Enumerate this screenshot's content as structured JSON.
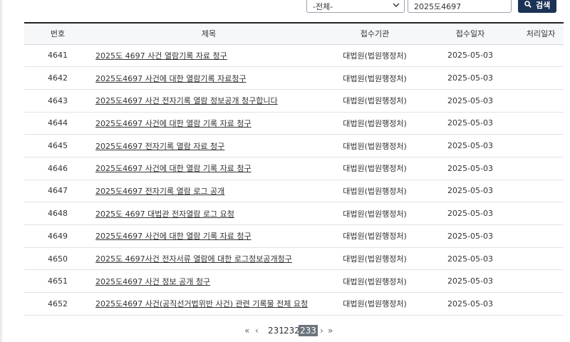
{
  "search": {
    "category_value": "-전체-",
    "query_value": "2025도4697",
    "button_label": "검색"
  },
  "table": {
    "headers": [
      "번호",
      "제목",
      "접수기관",
      "접수일자",
      "처리일자"
    ],
    "rows": [
      {
        "no": "4641",
        "title": "2025도 4697 사건 열람기록 자료 청구",
        "org": "대법원(법원행정처)",
        "date": "2025-05-03",
        "processed": ""
      },
      {
        "no": "4642",
        "title": "2025도4697 사건에 대한 열람기록 자료청구",
        "org": "대법원(법원행정처)",
        "date": "2025-05-03",
        "processed": ""
      },
      {
        "no": "4643",
        "title": "2025도4697 사건 전자기록 열람 정보공개 청구합니다",
        "org": "대법원(법원행정처)",
        "date": "2025-05-03",
        "processed": ""
      },
      {
        "no": "4644",
        "title": "2025도4697 사건에 대한 열람 기록 자료 청구",
        "org": "대법원(법원행정처)",
        "date": "2025-05-03",
        "processed": ""
      },
      {
        "no": "4645",
        "title": "2025도4697 전자기록 열람 자료 청구",
        "org": "대법원(법원행정처)",
        "date": "2025-05-03",
        "processed": ""
      },
      {
        "no": "4646",
        "title": "2025도4697 사건에 대한 열람 기록 자료 청구",
        "org": "대법원(법원행정처)",
        "date": "2025-05-03",
        "processed": ""
      },
      {
        "no": "4647",
        "title": "2025도4697 전자기록 열람 로그 공개",
        "org": "대법원(법원행정처)",
        "date": "2025-05-03",
        "processed": ""
      },
      {
        "no": "4648",
        "title": "2025도 4697 대법관 전자열람 로그 요청",
        "org": "대법원(법원행정처)",
        "date": "2025-05-03",
        "processed": ""
      },
      {
        "no": "4649",
        "title": "2025도4697 사건에 대한 열람 기록 자료 청구",
        "org": "대법원(법원행정처)",
        "date": "2025-05-03",
        "processed": ""
      },
      {
        "no": "4650",
        "title": "2025도 4697사건 전자서류 열람에 대한 로그정보공개청구",
        "org": "대법원(법원행정처)",
        "date": "2025-05-03",
        "processed": ""
      },
      {
        "no": "4651",
        "title": "2025도4697 사건 정보 공개 청구",
        "org": "대법원(법원행정처)",
        "date": "2025-05-03",
        "processed": ""
      },
      {
        "no": "4652",
        "title": "2025도4697 사건(공직선거법위반 사건) 관련 기록물 전체 요청",
        "org": "대법원(법원행정처)",
        "date": "2025-05-03",
        "processed": ""
      }
    ]
  },
  "pagination": {
    "first": "«",
    "prev": "‹",
    "pages": [
      "231",
      "232"
    ],
    "current": "233",
    "next": "›",
    "last": "»"
  }
}
